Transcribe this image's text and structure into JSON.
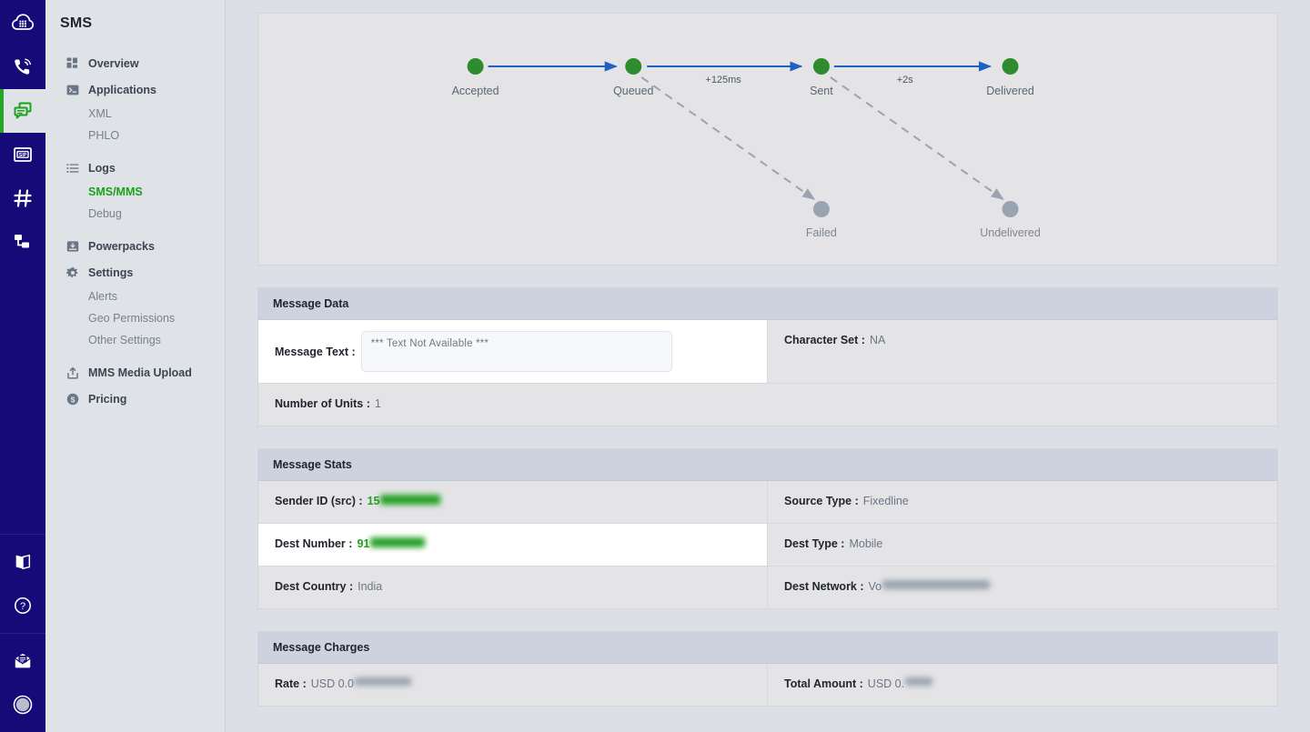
{
  "rail": {
    "items": [
      {
        "name": "logo",
        "icon": "cloud-grid-icon",
        "active": false
      },
      {
        "name": "voice",
        "icon": "phone-waves-icon",
        "active": false
      },
      {
        "name": "messaging",
        "icon": "chat-bubbles-icon",
        "active": true
      },
      {
        "name": "sip",
        "icon": "sip-trunk-icon",
        "active": false
      },
      {
        "name": "numbers",
        "icon": "hash-icon",
        "active": false
      },
      {
        "name": "network",
        "icon": "node-tree-icon",
        "active": false
      }
    ],
    "bottom_items": [
      {
        "name": "docs",
        "icon": "book-icon"
      },
      {
        "name": "help",
        "icon": "question-circle-icon"
      },
      {
        "name": "billing",
        "icon": "invoice-envelope-icon"
      },
      {
        "name": "account",
        "icon": "avatar-circle-icon"
      }
    ]
  },
  "sidebar": {
    "title": "SMS",
    "items": [
      {
        "label": "Overview",
        "icon": "dashboard-grid-icon",
        "type": "item"
      },
      {
        "label": "Applications",
        "icon": "terminal-icon",
        "type": "item"
      },
      {
        "label": "XML",
        "type": "sub"
      },
      {
        "label": "PHLO",
        "type": "sub"
      },
      {
        "label": "Logs",
        "icon": "list-icon",
        "type": "item"
      },
      {
        "label": "SMS/MMS",
        "type": "sub",
        "active": true
      },
      {
        "label": "Debug",
        "type": "sub"
      },
      {
        "label": "Powerpacks",
        "icon": "powerpack-icon",
        "type": "item"
      },
      {
        "label": "Settings",
        "icon": "gear-icon",
        "type": "item"
      },
      {
        "label": "Alerts",
        "type": "sub"
      },
      {
        "label": "Geo Permissions",
        "type": "sub"
      },
      {
        "label": "Other Settings",
        "type": "sub"
      },
      {
        "label": "MMS Media Upload",
        "icon": "upload-icon",
        "type": "item"
      },
      {
        "label": "Pricing",
        "icon": "dollar-circle-icon",
        "type": "item"
      }
    ]
  },
  "flow": {
    "nodes": [
      {
        "id": "accepted",
        "label": "Accepted",
        "state": "done"
      },
      {
        "id": "queued",
        "label": "Queued",
        "state": "done"
      },
      {
        "id": "sent",
        "label": "Sent",
        "state": "done"
      },
      {
        "id": "delivered",
        "label": "Delivered",
        "state": "done"
      },
      {
        "id": "failed",
        "label": "Failed",
        "state": "inactive"
      },
      {
        "id": "undelivered",
        "label": "Undelivered",
        "state": "inactive"
      }
    ],
    "edges": [
      {
        "from": "accepted",
        "to": "queued",
        "label": "",
        "style": "solid"
      },
      {
        "from": "queued",
        "to": "sent",
        "label": "+125ms",
        "style": "solid"
      },
      {
        "from": "sent",
        "to": "delivered",
        "label": "+2s",
        "style": "solid"
      },
      {
        "from": "queued",
        "to": "failed",
        "label": "",
        "style": "dashed"
      },
      {
        "from": "sent",
        "to": "undelivered",
        "label": "",
        "style": "dashed"
      }
    ],
    "colors": {
      "active_node": "#2e8b2e",
      "inactive_node": "#9aa4b0",
      "solid_edge": "#2060c0",
      "dashed_edge": "#9aa4b0"
    }
  },
  "message_data": {
    "header": "Message Data",
    "message_text_label": "Message Text :",
    "message_text_value": "*** Text Not Available ***",
    "character_set_label": "Character Set :",
    "character_set_value": "NA",
    "number_of_units_label": "Number of Units :",
    "number_of_units_value": "1"
  },
  "message_stats": {
    "header": "Message Stats",
    "sender_id_label": "Sender ID (src) :",
    "sender_id_value": "15",
    "sender_id_redacted": true,
    "source_type_label": "Source Type :",
    "source_type_value": "Fixedline",
    "dest_number_label": "Dest Number :",
    "dest_number_value": "91",
    "dest_number_redacted": true,
    "dest_type_label": "Dest Type :",
    "dest_type_value": "Mobile",
    "dest_country_label": "Dest Country :",
    "dest_country_value": "India",
    "dest_network_label": "Dest Network :",
    "dest_network_value": "Vo",
    "dest_network_redacted": true
  },
  "message_charges": {
    "header": "Message Charges",
    "rate_label": "Rate :",
    "rate_value": "USD 0.0",
    "rate_redacted": true,
    "total_amount_label": "Total Amount :",
    "total_amount_value": "USD 0.",
    "total_amount_redacted": true
  }
}
